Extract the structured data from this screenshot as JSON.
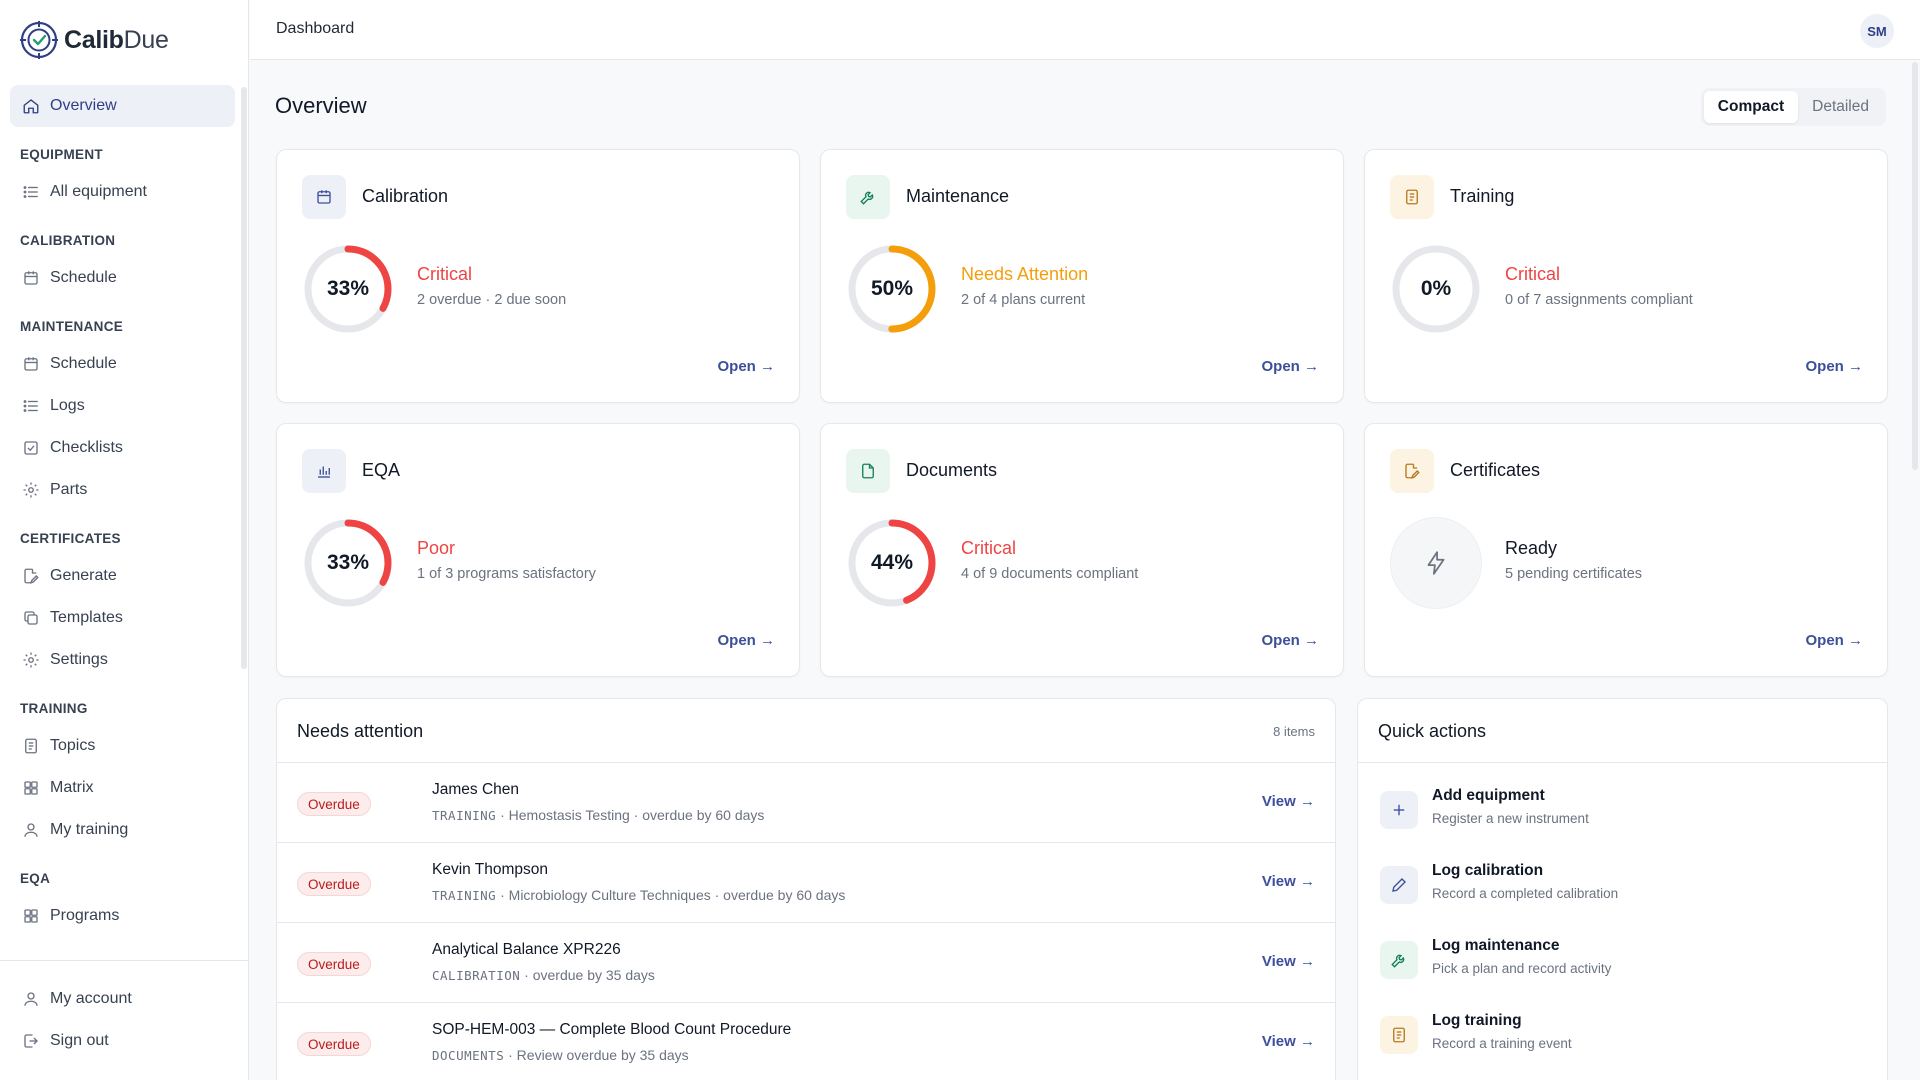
{
  "app": {
    "brand_bold": "Calib",
    "brand_light": "Due"
  },
  "sidebar": {
    "overview": "Overview",
    "sections": {
      "equipment": "EQUIPMENT",
      "calibration": "CALIBRATION",
      "maintenance": "MAINTENANCE",
      "certificates": "CERTIFICATES",
      "training": "TRAINING",
      "eqa": "EQA"
    },
    "items": {
      "all_equipment": "All equipment",
      "calibration_schedule": "Schedule",
      "maintenance_schedule": "Schedule",
      "logs": "Logs",
      "checklists": "Checklists",
      "parts": "Parts",
      "generate": "Generate",
      "templates": "Templates",
      "settings": "Settings",
      "topics": "Topics",
      "matrix": "Matrix",
      "my_training": "My training",
      "programs": "Programs"
    },
    "bottom": {
      "my_account": "My account",
      "sign_out": "Sign out"
    }
  },
  "topbar": {
    "title": "Dashboard",
    "avatar": "SM"
  },
  "main": {
    "title": "Overview",
    "view_modes": {
      "compact": "Compact",
      "detailed": "Detailed",
      "selected": "Compact"
    }
  },
  "cards": {
    "calibration": {
      "title": "Calibration",
      "percent": 33,
      "percent_label": "33%",
      "status": "Critical",
      "detail": "2 overdue · 2 due soon",
      "link": "Open →"
    },
    "maintenance": {
      "title": "Maintenance",
      "percent": 50,
      "percent_label": "50%",
      "status": "Needs Attention",
      "detail": "2 of 4 plans current",
      "link": "Open →"
    },
    "training": {
      "title": "Training",
      "percent": 0,
      "percent_label": "0%",
      "status": "Critical",
      "detail": "0 of 7 assignments compliant",
      "link": "Open →"
    },
    "eqa": {
      "title": "EQA",
      "percent": 33,
      "percent_label": "33%",
      "status": "Poor",
      "detail": "1 of 3 programs satisfactory",
      "link": "Open →"
    },
    "documents": {
      "title": "Documents",
      "percent": 44,
      "percent_label": "44%",
      "status": "Critical",
      "detail": "4 of 9 documents compliant",
      "link": "Open →"
    },
    "certificates": {
      "title": "Certificates",
      "status": "Ready",
      "detail": "5 pending certificates",
      "link": "Open →"
    }
  },
  "colors": {
    "critical": "#ef4444",
    "warning": "#f59e0b",
    "accent": "#2f3f86",
    "track": "#e5e7eb"
  },
  "needs_attention": {
    "title": "Needs attention",
    "count": "8 items",
    "rows": [
      {
        "badge": "Overdue",
        "name": "James Chen",
        "category": "TRAINING",
        "detail": " · Hemostasis Testing · overdue by 60 days",
        "link": "View →"
      },
      {
        "badge": "Overdue",
        "name": "Kevin Thompson",
        "category": "TRAINING",
        "detail": " · Microbiology Culture Techniques · overdue by 60 days",
        "link": "View →"
      },
      {
        "badge": "Overdue",
        "name": "Analytical Balance XPR226",
        "category": "CALIBRATION",
        "detail": " · overdue by 35 days",
        "link": "View →"
      },
      {
        "badge": "Overdue",
        "name": "SOP-HEM-003 — Complete Blood Count Procedure",
        "category": "DOCUMENTS",
        "detail": " · Review overdue by 35 days",
        "link": "View →"
      }
    ]
  },
  "quick_actions": {
    "title": "Quick actions",
    "items": [
      {
        "title": "Add equipment",
        "subtitle": "Register a new instrument",
        "icon": "plus-icon"
      },
      {
        "title": "Log calibration",
        "subtitle": "Record a completed calibration",
        "icon": "pencil-icon"
      },
      {
        "title": "Log maintenance",
        "subtitle": "Pick a plan and record activity",
        "icon": "wrench-icon"
      },
      {
        "title": "Log training",
        "subtitle": "Record a training event",
        "icon": "list-icon"
      }
    ]
  }
}
